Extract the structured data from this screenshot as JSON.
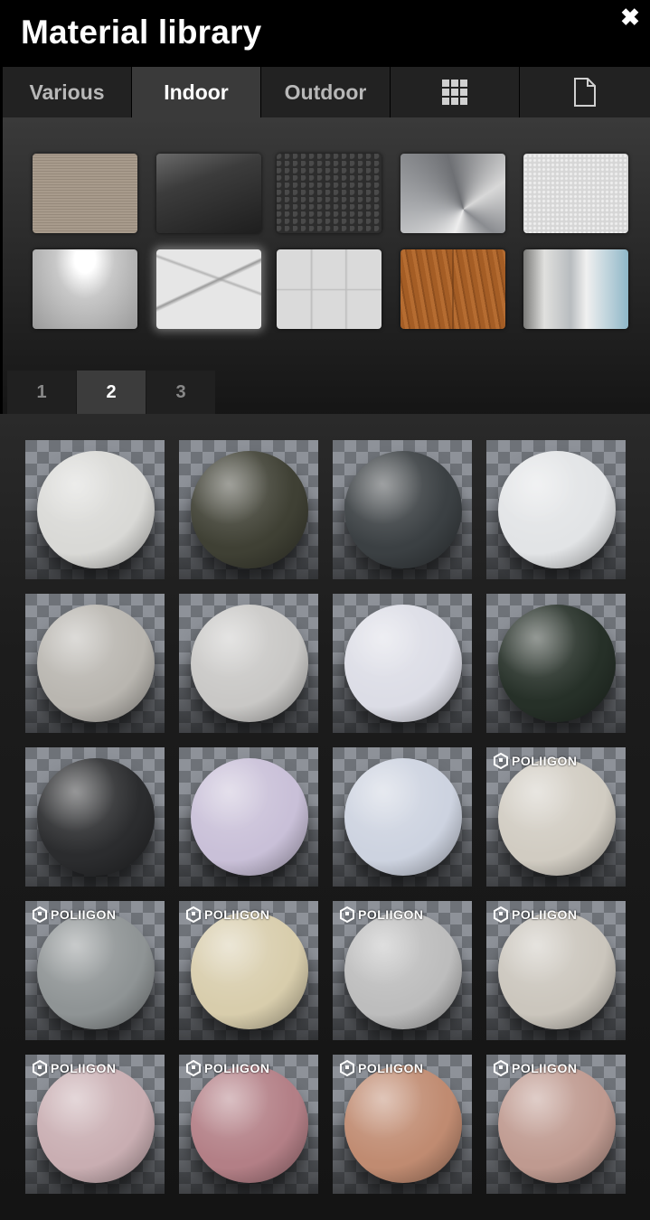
{
  "window": {
    "title": "Material library",
    "close_label": "✖"
  },
  "tabs": [
    {
      "label": "Various",
      "active": false
    },
    {
      "label": "Indoor",
      "active": true
    },
    {
      "label": "Outdoor",
      "active": false
    },
    {
      "label": "",
      "icon": "grid-icon"
    },
    {
      "label": "",
      "icon": "document-icon"
    }
  ],
  "thumbnails": [
    {
      "name": "fabric",
      "color": "#cfc7bd"
    },
    {
      "name": "glass",
      "color": "#3c3c3c"
    },
    {
      "name": "leather",
      "color": "#2d2d2d"
    },
    {
      "name": "brushed-metal",
      "color": "#a9abae"
    },
    {
      "name": "plaster",
      "color": "#d6d6d6"
    },
    {
      "name": "glossy-white",
      "color": "#c8c8c8"
    },
    {
      "name": "marble",
      "color": "#e6e6e6",
      "selected": true
    },
    {
      "name": "tiles",
      "color": "#dadada"
    },
    {
      "name": "wood",
      "color": "#a45d25"
    },
    {
      "name": "mirror",
      "color": "#b8bcbf"
    }
  ],
  "pages": [
    {
      "label": "1",
      "active": false
    },
    {
      "label": "2",
      "active": true
    },
    {
      "label": "3",
      "active": false
    }
  ],
  "materials": [
    {
      "color": "#d9d9d6",
      "badge": ""
    },
    {
      "color": "#3f4034",
      "badge": ""
    },
    {
      "color": "#3b4043",
      "badge": ""
    },
    {
      "color": "#e2e4e6",
      "badge": ""
    },
    {
      "color": "#b9b6b0",
      "badge": ""
    },
    {
      "color": "#c9c8c6",
      "badge": ""
    },
    {
      "color": "#dcdde6",
      "badge": ""
    },
    {
      "color": "#263028",
      "badge": ""
    },
    {
      "color": "#2b2c2e",
      "badge": ""
    },
    {
      "color": "#c9c0d8",
      "badge": ""
    },
    {
      "color": "#cdd3e0",
      "badge": ""
    },
    {
      "color": "#d1ccc2",
      "badge": "POLIIGON"
    },
    {
      "color": "#8f9495",
      "badge": "POLIIGON"
    },
    {
      "color": "#d8cdac",
      "badge": "POLIIGON"
    },
    {
      "color": "#bdbdbd",
      "badge": "POLIIGON"
    },
    {
      "color": "#cbc6bd",
      "badge": "POLIIGON"
    },
    {
      "color": "#c9aeb2",
      "badge": "POLIIGON"
    },
    {
      "color": "#b37f86",
      "badge": "POLIIGON"
    },
    {
      "color": "#c08b71",
      "badge": "POLIIGON"
    },
    {
      "color": "#bf9a90",
      "badge": "POLIIGON"
    }
  ]
}
